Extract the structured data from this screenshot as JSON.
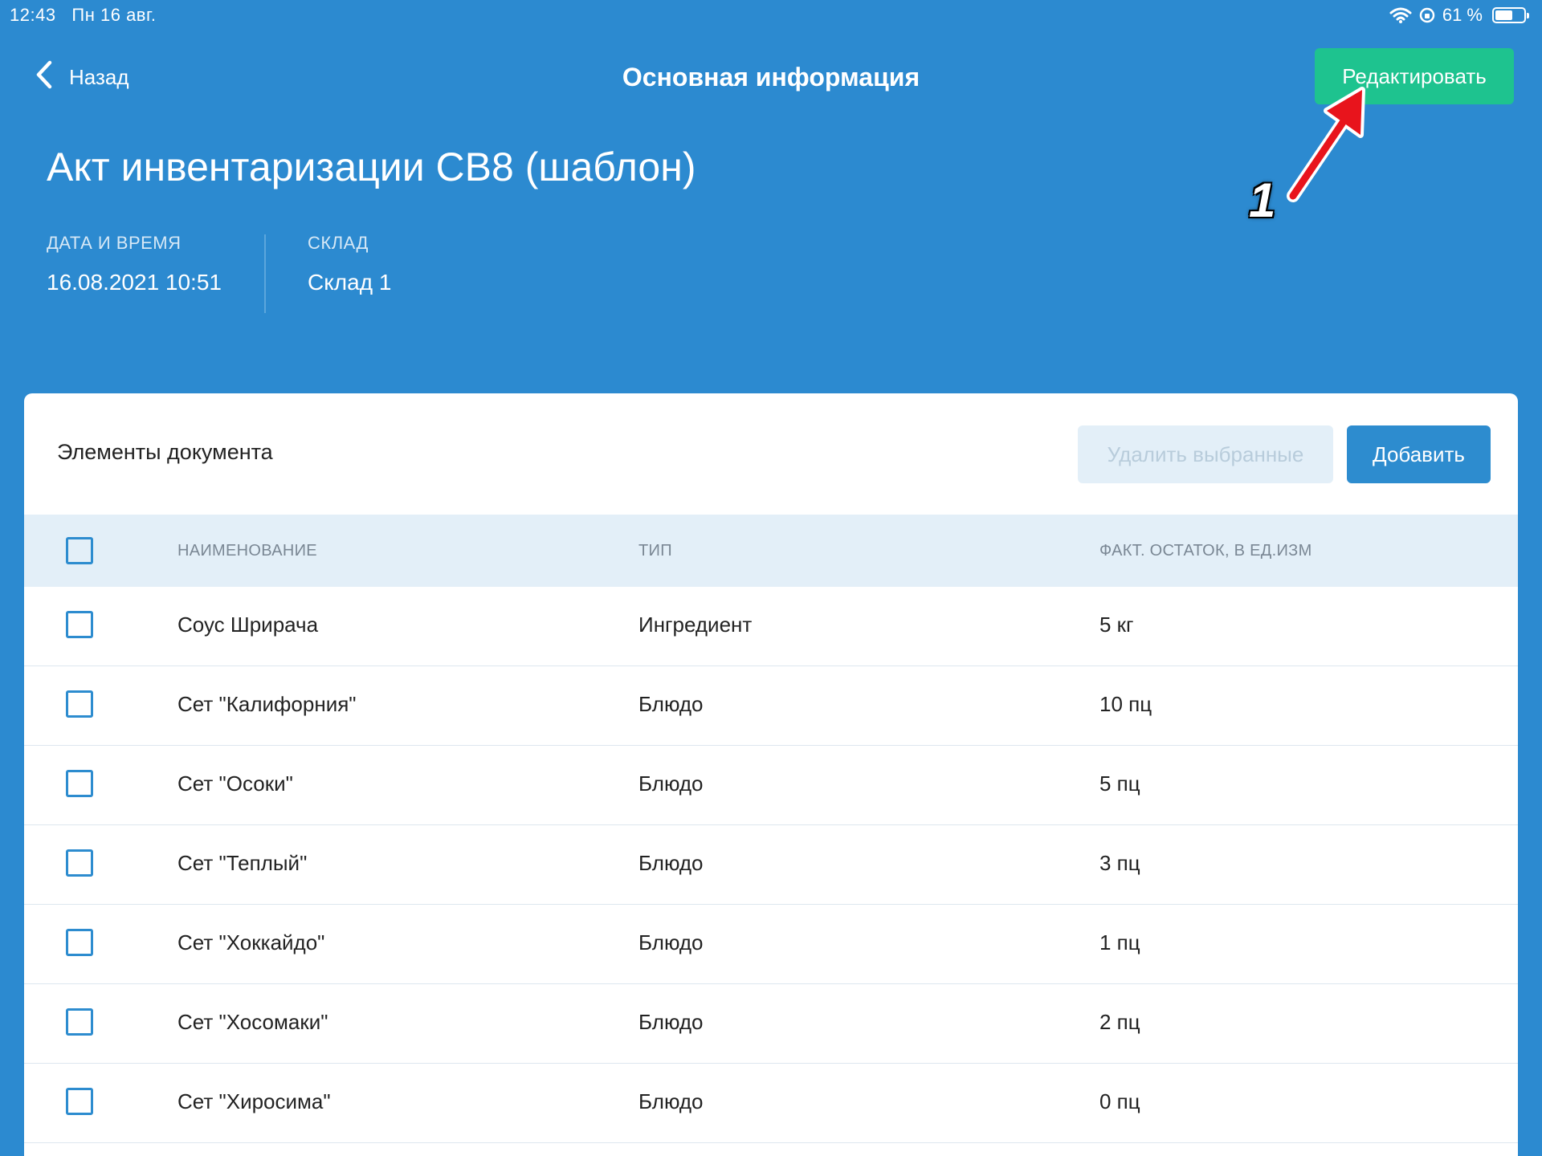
{
  "status_bar": {
    "time": "12:43",
    "date": "Пн 16 авг.",
    "battery_text": "61 %",
    "battery_level": 0.61
  },
  "nav": {
    "back_label": "Назад",
    "title": "Основная информация",
    "edit_label": "Редактировать"
  },
  "document": {
    "title": "Акт инвентаризации СВ8 (шаблон)",
    "date_label": "ДАТА И ВРЕМЯ",
    "date_value": "16.08.2021 10:51",
    "warehouse_label": "СКЛАД",
    "warehouse_value": "Склад 1"
  },
  "annotation": {
    "label": "1",
    "color": "#e8141c"
  },
  "items": {
    "section_title": "Элементы документа",
    "delete_label": "Удалить выбранные",
    "add_label": "Добавить",
    "columns": {
      "name": "НАИМЕНОВАНИЕ",
      "type": "ТИП",
      "qty": "ФАКТ. ОСТАТОК, В ЕД.ИЗМ"
    },
    "rows": [
      {
        "name": "Соус Шрирача",
        "type": "Ингредиент",
        "qty": "5 кг"
      },
      {
        "name": "Сет \"Калифорния\"",
        "type": "Блюдо",
        "qty": "10 пц"
      },
      {
        "name": "Сет \"Осоки\"",
        "type": "Блюдо",
        "qty": "5 пц"
      },
      {
        "name": "Сет \"Теплый\"",
        "type": "Блюдо",
        "qty": "3 пц"
      },
      {
        "name": "Сет \"Хоккайдо\"",
        "type": "Блюдо",
        "qty": "1 пц"
      },
      {
        "name": "Сет \"Хосомаки\"",
        "type": "Блюдо",
        "qty": "2 пц"
      },
      {
        "name": "Сет \"Хиросима\"",
        "type": "Блюдо",
        "qty": "0 пц"
      }
    ]
  },
  "colors": {
    "background": "#2c8ad0",
    "accent_green": "#1ec38f",
    "accent_blue": "#2d8ccf"
  }
}
